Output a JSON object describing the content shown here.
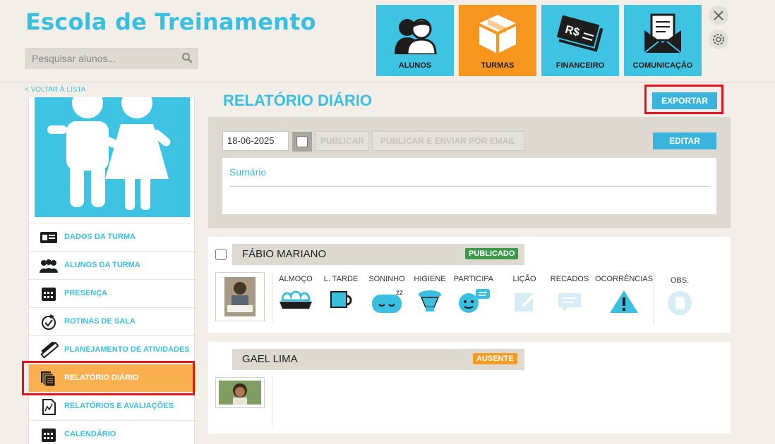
{
  "header": {
    "app_title": "Escola de Treinamento",
    "search_placeholder": "Pesquisar alunos...",
    "nav": [
      {
        "label": "ALUNOS",
        "icon": "students-icon"
      },
      {
        "label": "TURMAS",
        "icon": "box-icon",
        "active": true
      },
      {
        "label": "FINANCEIRO",
        "icon": "money-icon"
      },
      {
        "label": "COMUNICAÇÃO",
        "icon": "envelope-icon"
      }
    ]
  },
  "back_link": "< VOLTAR À LISTA",
  "sidebar": {
    "menu": [
      {
        "label": "DADOS DA TURMA",
        "icon": "id-card-icon"
      },
      {
        "label": "ALUNOS DA TURMA",
        "icon": "group-icon"
      },
      {
        "label": "PRESENÇA",
        "icon": "calendar-icon"
      },
      {
        "label": "ROTINAS DE SALA",
        "icon": "routine-icon"
      },
      {
        "label": "PLANEJAMENTO DE ATIVIDADES",
        "icon": "pencil-ruler-icon"
      },
      {
        "label": "RELATÓRIO DIÁRIO",
        "icon": "report-icon",
        "active": true
      },
      {
        "label": "RELATÓRIOS E AVALIAÇÕES",
        "icon": "chart-doc-icon"
      },
      {
        "label": "CALENDÁRIO",
        "icon": "calendar-icon"
      }
    ]
  },
  "main": {
    "title": "RELATÓRIO DIÁRIO",
    "export_label": "EXPORTAR",
    "date": "18-06-2025",
    "publish_label": "PUBLICAR",
    "publish_email_label": "PUBLICAR E ENVIAR POR EMAIL",
    "edit_label": "EDITAR",
    "summary_label": "Sumário"
  },
  "students": [
    {
      "name": "FÁBIO MARIANO",
      "status": "PUBLICADO",
      "status_color": "#3a9a4a"
    },
    {
      "name": "GAEL LIMA",
      "status": "AUSENTE",
      "status_color": "#f39b22"
    }
  ],
  "categories": [
    "ALMOÇO",
    "L. TARDE",
    "SONINHO",
    "HIGIENE",
    "PARTICIPA",
    "LIÇÃO",
    "RECADOS",
    "OCORRÊNCIAS",
    "OBS."
  ],
  "colors": {
    "accent": "#3bbfe0",
    "tile": "#3fc3e2",
    "active_tile": "#f7961e",
    "highlight": "#e8121a"
  }
}
